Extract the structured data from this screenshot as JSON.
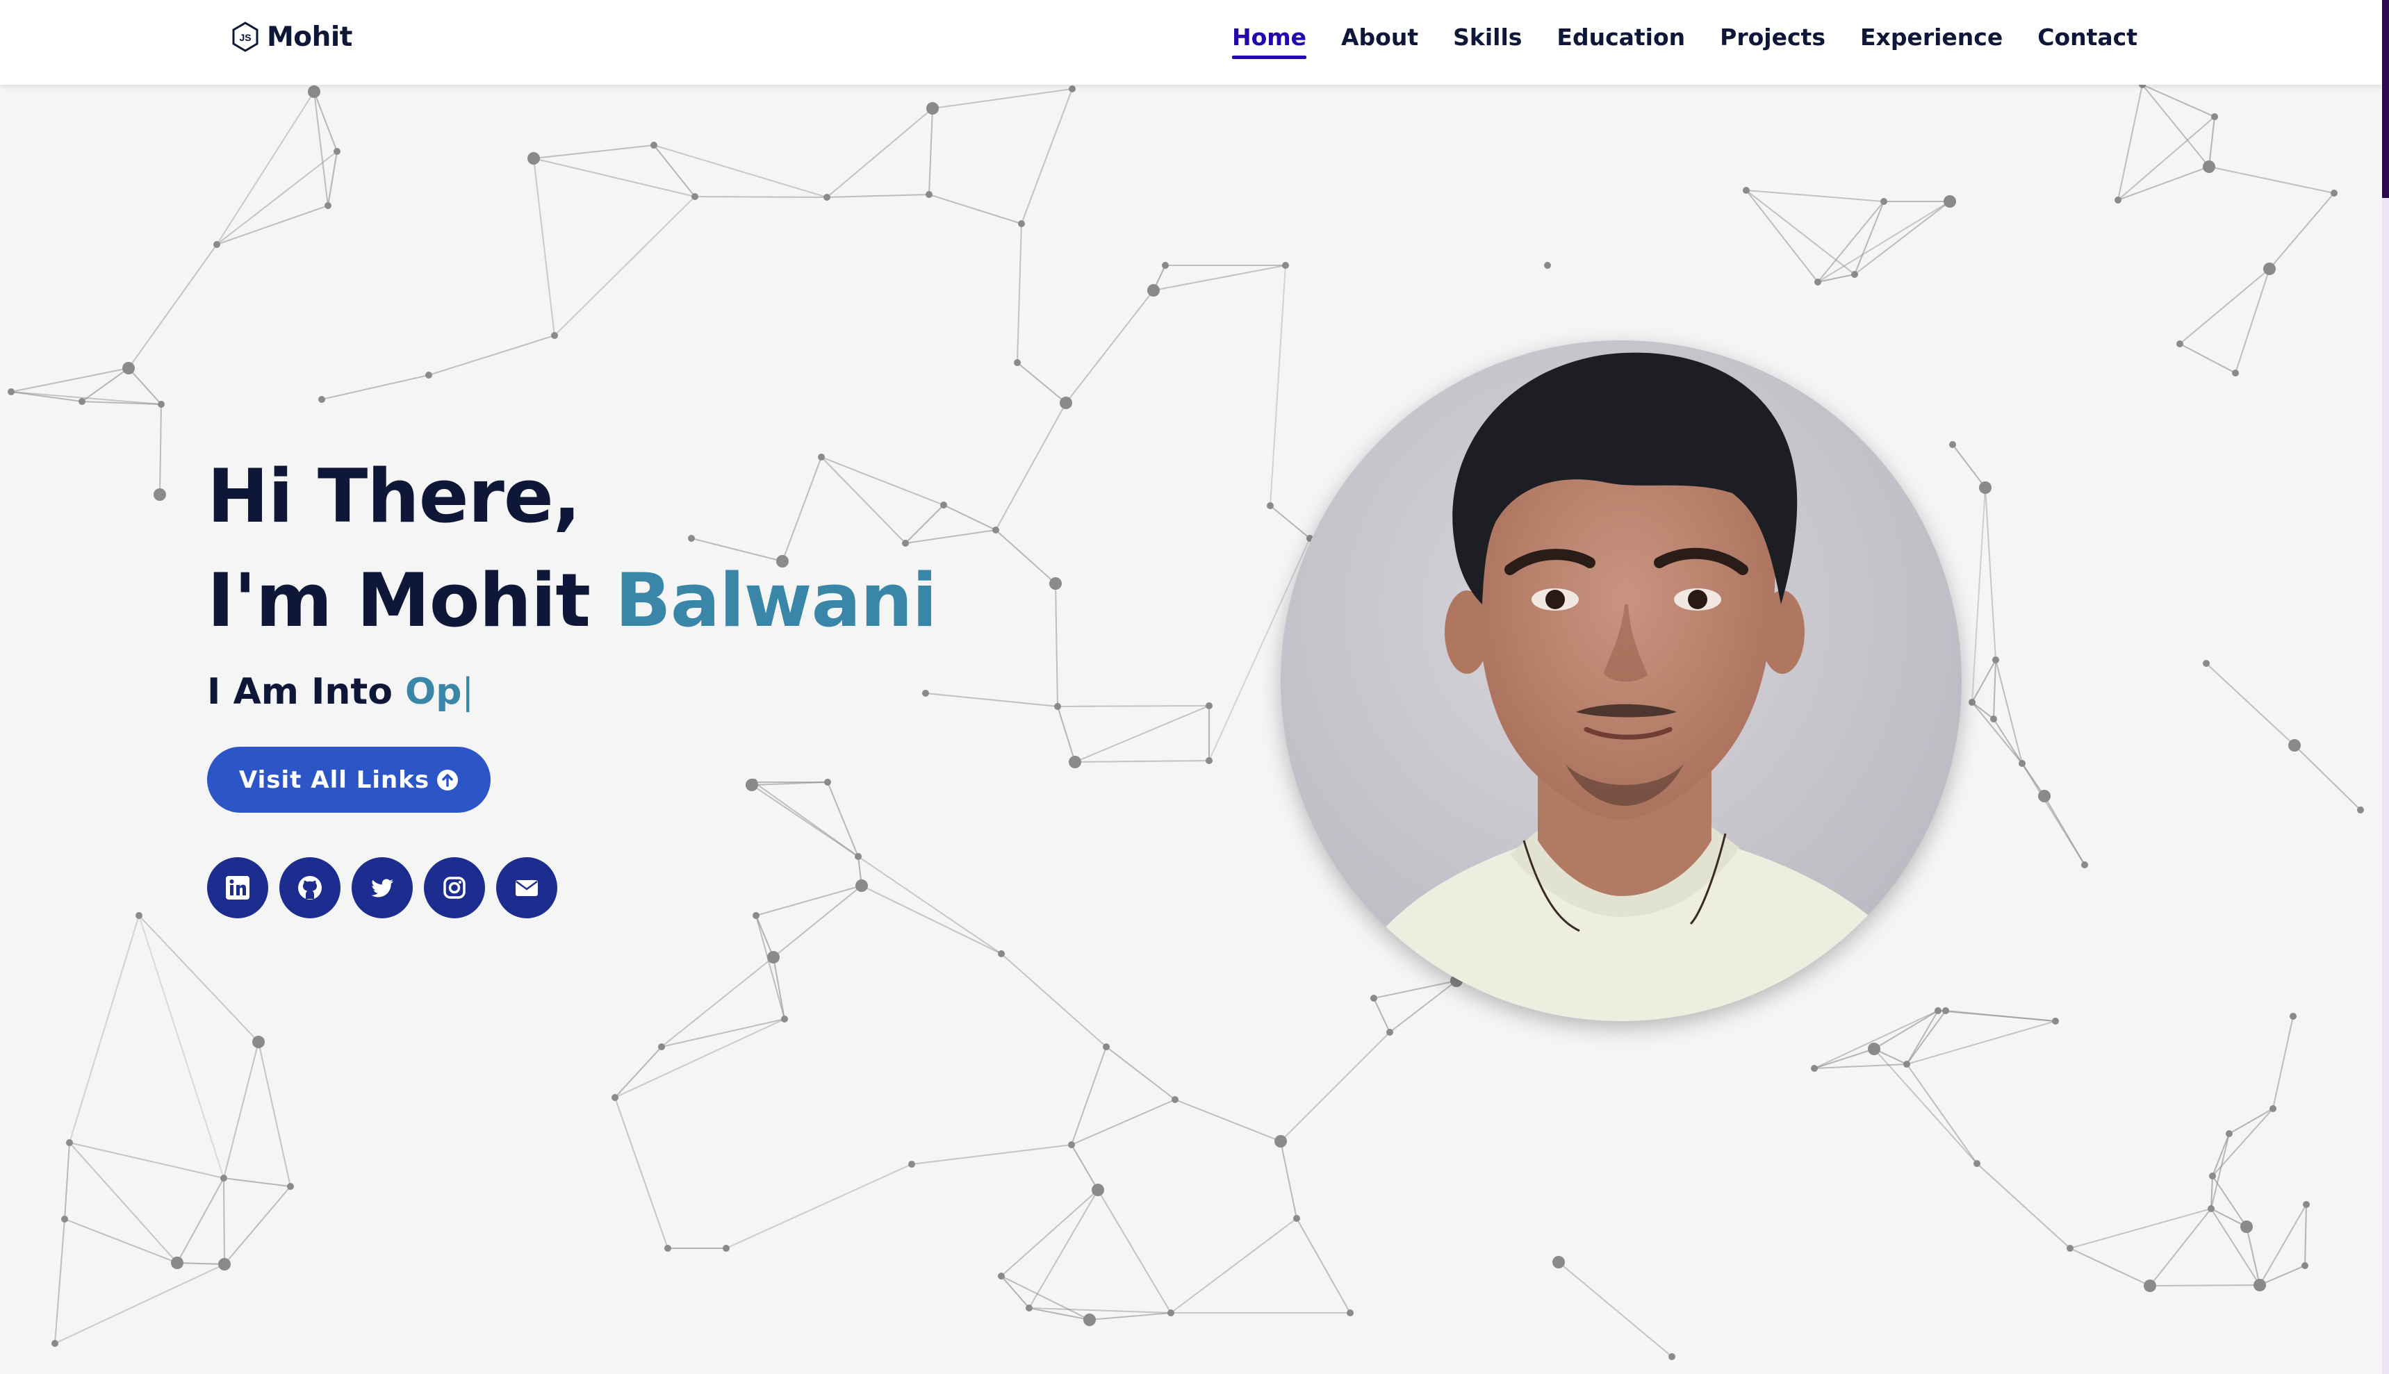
{
  "brand": {
    "icon": "js-hexagon-icon",
    "name": "Mohit"
  },
  "nav": {
    "items": [
      {
        "label": "Home",
        "active": true
      },
      {
        "label": "About",
        "active": false
      },
      {
        "label": "Skills",
        "active": false
      },
      {
        "label": "Education",
        "active": false
      },
      {
        "label": "Projects",
        "active": false
      },
      {
        "label": "Experience",
        "active": false
      },
      {
        "label": "Contact",
        "active": false
      }
    ]
  },
  "hero": {
    "greeting": "Hi There,",
    "intro": "I'm Mohit ",
    "surname": "Balwani",
    "typed_prefix": "I Am Into ",
    "typed_text": "Op",
    "typed_cursor": "|",
    "cta_label": "Visit All Links",
    "cta_icon": "arrow-up-circle-icon"
  },
  "socials": [
    {
      "name": "linkedin",
      "icon": "linkedin-icon"
    },
    {
      "name": "github",
      "icon": "github-icon"
    },
    {
      "name": "twitter",
      "icon": "twitter-icon"
    },
    {
      "name": "instagram",
      "icon": "instagram-icon"
    },
    {
      "name": "email",
      "icon": "envelope-icon"
    }
  ],
  "profile_photo": {
    "alt": "profile photo"
  },
  "colors": {
    "navy": "#0e1737",
    "accent": "#3a86a8",
    "nav_active": "#2506ad",
    "button": "#2c55c8",
    "social_bg": "#1d2d8f",
    "background": "#f5f5f6"
  }
}
